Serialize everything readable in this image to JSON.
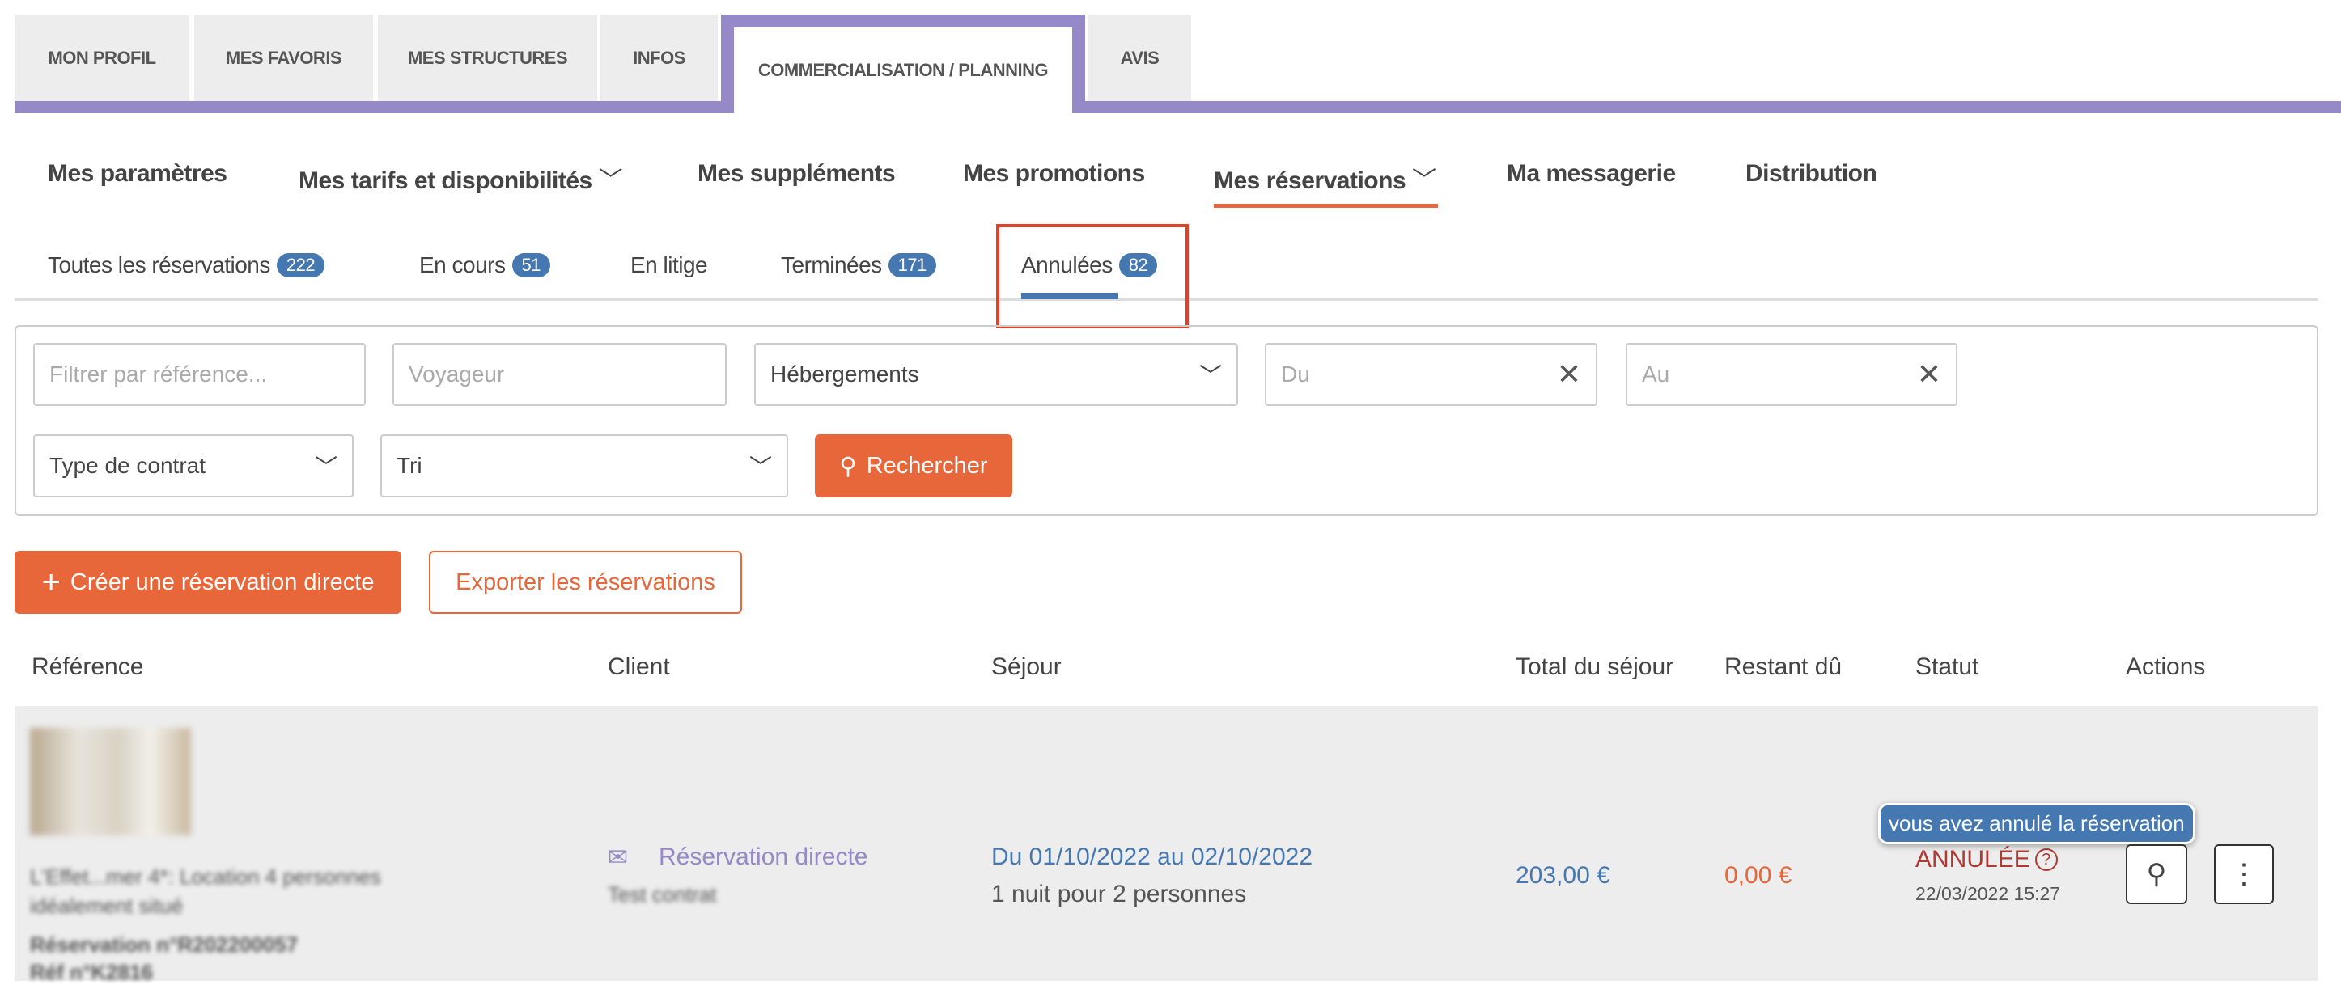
{
  "top_tabs": [
    {
      "label": "MON PROFIL"
    },
    {
      "label": "MES FAVORIS"
    },
    {
      "label": "MES STRUCTURES"
    },
    {
      "label": "INFOS"
    },
    {
      "label": "COMMERCIALISATION / PLANNING",
      "active": true
    },
    {
      "label": "AVIS"
    }
  ],
  "nav": [
    "Mes paramètres",
    "Mes tarifs et disponibilités",
    "Mes suppléments",
    "Mes promotions",
    "Mes réservations",
    "Ma messagerie",
    "Distribution"
  ],
  "sub_tabs": [
    {
      "label": "Toutes les réservations",
      "count": "222"
    },
    {
      "label": "En cours",
      "count": "51"
    },
    {
      "label": "En litige"
    },
    {
      "label": "Terminées",
      "count": "171"
    },
    {
      "label": "Annulées",
      "count": "82",
      "active": true
    }
  ],
  "filters": {
    "reference_placeholder": "Filtrer par référence...",
    "voyageur_placeholder": "Voyageur",
    "hebergements": "Hébergements",
    "du_placeholder": "Du",
    "au_placeholder": "Au",
    "type_contrat": "Type de contrat",
    "tri": "Tri",
    "search_label": "Rechercher"
  },
  "actions": {
    "create_label": "Créer une réservation directe",
    "export_label": "Exporter les réservations"
  },
  "table": {
    "headers": [
      "Référence",
      "Client",
      "Séjour",
      "Total du séjour",
      "Restant dû",
      "Statut",
      "Actions"
    ],
    "rows": [
      {
        "property": "L'Effet...mer 4*: Location 4 personnes idéalement situé",
        "reservation_no": "Réservation n°R202200057",
        "ref": "Réf n°K2816",
        "client": "Réservation directe",
        "contract": "Test contrat",
        "dates": "Du 01/10/2022 au 02/10/2022",
        "nights": "1 nuit pour 2 personnes",
        "total": "203,00 €",
        "remaining": "0,00 €",
        "status": "ANNULÉE",
        "status_date": "22/03/2022 15:27",
        "tooltip": "vous avez annulé la réservation"
      }
    ]
  },
  "colors": {
    "accent": "#e8673a",
    "purple": "#9589c8",
    "blue": "#4577b1",
    "cancel": "#b03a32",
    "highlight_box": "#e0412a"
  }
}
